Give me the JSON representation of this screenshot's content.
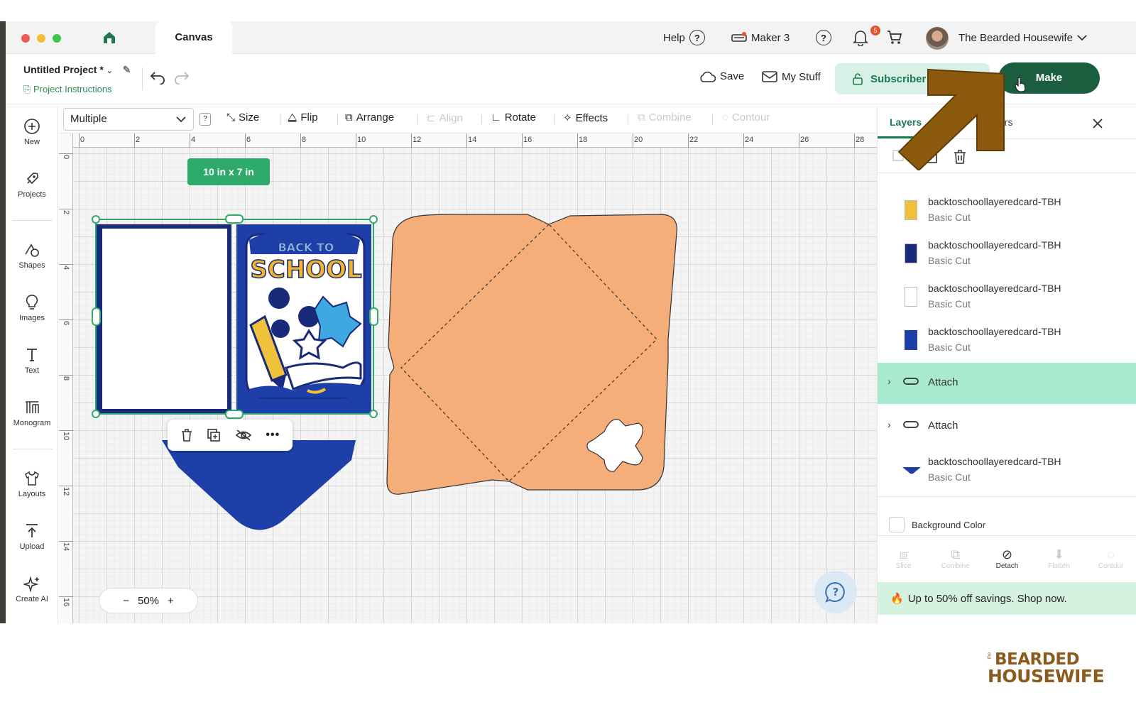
{
  "titlebar": {
    "tab": "Canvas",
    "help": "Help",
    "machine": "Maker 3",
    "notif_count": "5",
    "user": "The Bearded Housewife"
  },
  "header": {
    "project_title": "Untitled Project *",
    "project_instructions": "Project Instructions",
    "save": "Save",
    "my_stuff": "My Stuff",
    "subscriber": "Subscriber",
    "make": "Make"
  },
  "sidebar": {
    "items": [
      {
        "label": "New",
        "icon": "plus-circle-icon"
      },
      {
        "label": "Projects",
        "icon": "rocket-icon"
      },
      {
        "label": "Shapes",
        "icon": "shapes-icon"
      },
      {
        "label": "Images",
        "icon": "lightbulb-icon"
      },
      {
        "label": "Text",
        "icon": "text-icon"
      },
      {
        "label": "Monogram",
        "icon": "monogram-icon"
      },
      {
        "label": "Layouts",
        "icon": "shirt-icon"
      },
      {
        "label": "Upload",
        "icon": "upload-icon"
      },
      {
        "label": "Create AI",
        "icon": "sparkle-icon"
      }
    ]
  },
  "toolbar": {
    "operation": "Multiple",
    "qm": "?",
    "size": "Size",
    "flip": "Flip",
    "arrange": "Arrange",
    "align": "Align",
    "rotate": "Rotate",
    "effects": "Effects",
    "combine": "Combine",
    "contour": "Contour"
  },
  "canvas": {
    "ruler_x": [
      "0",
      "2",
      "4",
      "6",
      "8",
      "10",
      "12",
      "14",
      "16",
      "18",
      "20",
      "22",
      "24",
      "26",
      "28"
    ],
    "ruler_y": [
      "0",
      "2",
      "4",
      "6",
      "8",
      "10",
      "12",
      "14",
      "16"
    ],
    "selection_size": "10 in x 7 in",
    "zoom": "50%",
    "card_title_top": "BACK TO",
    "card_title_main": "SCHOOL"
  },
  "layers_panel": {
    "tab_layers": "Layers",
    "tab_colors": "Colors",
    "layers": [
      {
        "name": "backtoschoollayeredcard-TBH",
        "op": "Basic Cut",
        "thumb": "#f0c23b"
      },
      {
        "name": "backtoschoollayeredcard-TBH",
        "op": "Basic Cut",
        "thumb": "#1a2a7a"
      },
      {
        "name": "backtoschoollayeredcard-TBH",
        "op": "Basic Cut",
        "thumb": "#ffffff"
      },
      {
        "name": "backtoschoollayeredcard-TBH",
        "op": "Basic Cut",
        "thumb": "#1f3fa8"
      }
    ],
    "attach_1": "Attach",
    "attach_2": "Attach",
    "last_layer": {
      "name": "backtoschoollayeredcard-TBH",
      "op": "Basic Cut"
    },
    "background_color": "Background Color",
    "bottom_tools": [
      "Slice",
      "Combine",
      "Detach",
      "Flatten",
      "Contour"
    ],
    "promo": "Up to 50% off savings. Shop now."
  },
  "logo": {
    "small": "the",
    "top": "BEARDED",
    "bottom": "HOUSEWIFE"
  },
  "colors": {
    "brand_green": "#1b5e3f",
    "card_blue": "#1f3fa8",
    "envelope": "#f5ad7a",
    "overlay_arrow": "#8b5a0f"
  }
}
